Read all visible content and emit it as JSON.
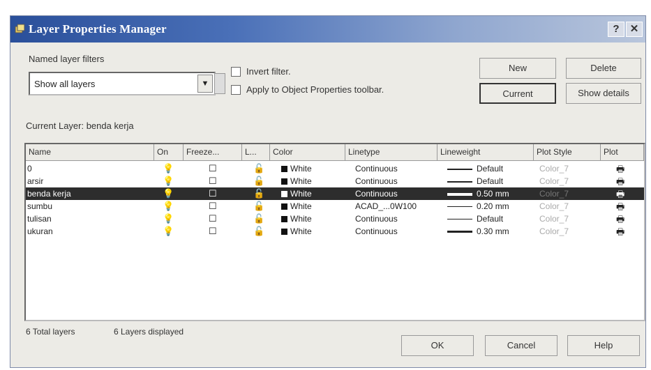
{
  "window": {
    "title": "Layer Properties Manager"
  },
  "filters": {
    "label": "Named layer filters",
    "selected": "Show all layers",
    "invert_label": "Invert filter.",
    "apply_label": "Apply to Object Properties toolbar."
  },
  "buttons": {
    "new": "New",
    "delete": "Delete",
    "current": "Current",
    "show_details": "Show details",
    "ok": "OK",
    "cancel": "Cancel",
    "help": "Help"
  },
  "current_layer": "Current Layer:  benda kerja",
  "columns": [
    "Name",
    "On",
    "Freeze...",
    "L...",
    "Color",
    "Linetype",
    "Lineweight",
    "Plot Style",
    "Plot"
  ],
  "layers": [
    {
      "name": "0",
      "color": "White",
      "linetype": "Continuous",
      "lineweight": "Default",
      "plot_style": "Color_7",
      "selected": false
    },
    {
      "name": "arsir",
      "color": "White",
      "linetype": "Continuous",
      "lineweight": "Default",
      "plot_style": "Color_7",
      "selected": false
    },
    {
      "name": "benda kerja",
      "color": "White",
      "linetype": "Continuous",
      "lineweight": "0.50 mm",
      "plot_style": "Color_7",
      "selected": true
    },
    {
      "name": "sumbu",
      "color": "White",
      "linetype": "ACAD_...0W100",
      "lineweight": "0.20 mm",
      "plot_style": "Color_7",
      "selected": false
    },
    {
      "name": "tulisan",
      "color": "White",
      "linetype": "Continuous",
      "lineweight": "Default",
      "plot_style": "Color_7",
      "selected": false
    },
    {
      "name": "ukuran",
      "color": "White",
      "linetype": "Continuous",
      "lineweight": "0.30 mm",
      "plot_style": "Color_7",
      "selected": false
    }
  ],
  "status": {
    "total": "6 Total layers",
    "displayed": "6 Layers displayed"
  },
  "icons": {
    "on": "lightbulb-icon",
    "freeze": "sun-icon",
    "lock": "lock-icon",
    "plot": "printer-icon"
  }
}
